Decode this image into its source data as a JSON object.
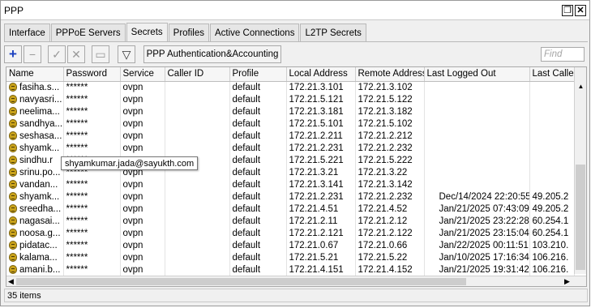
{
  "window": {
    "title": "PPP",
    "restore_glyph": "❐",
    "close_glyph": "✕"
  },
  "tabs": [
    "Interface",
    "PPPoE Servers",
    "Secrets",
    "Profiles",
    "Active Connections",
    "L2TP Secrets"
  ],
  "toolbar": {
    "add_glyph": "+",
    "remove_glyph": "−",
    "enable_glyph": "✓",
    "disable_glyph": "✕",
    "comment_glyph": "▭",
    "filter_glyph": "▽",
    "auth_label": "PPP Authentication&Accounting",
    "find_placeholder": "Find"
  },
  "columns": [
    "Name",
    "Password",
    "Service",
    "Caller ID",
    "Profile",
    "Local Address",
    "Remote Address",
    "Last Logged Out",
    "Last Calle"
  ],
  "rows": [
    {
      "name": "fasiha.s...",
      "password": "******",
      "service": "ovpn",
      "caller_id": "",
      "profile": "default",
      "local": "172.21.3.101",
      "remote": "172.21.3.102",
      "last_out": "",
      "last_caller": ""
    },
    {
      "name": "navyasri...",
      "password": "******",
      "service": "ovpn",
      "caller_id": "",
      "profile": "default",
      "local": "172.21.5.121",
      "remote": "172.21.5.122",
      "last_out": "",
      "last_caller": ""
    },
    {
      "name": "neelima...",
      "password": "******",
      "service": "ovpn",
      "caller_id": "",
      "profile": "default",
      "local": "172.21.3.181",
      "remote": "172.21.3.182",
      "last_out": "",
      "last_caller": ""
    },
    {
      "name": "sandhya...",
      "password": "******",
      "service": "ovpn",
      "caller_id": "",
      "profile": "default",
      "local": "172.21.5.101",
      "remote": "172.21.5.102",
      "last_out": "",
      "last_caller": ""
    },
    {
      "name": "seshasa...",
      "password": "******",
      "service": "ovpn",
      "caller_id": "",
      "profile": "default",
      "local": "172.21.2.211",
      "remote": "172.21.2.212",
      "last_out": "",
      "last_caller": ""
    },
    {
      "name": "shyamk...",
      "password": "******",
      "service": "ovpn",
      "caller_id": "",
      "profile": "default",
      "local": "172.21.2.231",
      "remote": "172.21.2.232",
      "last_out": "",
      "last_caller": ""
    },
    {
      "name": "sindhu.r",
      "password": "******",
      "service": "ovpn",
      "caller_id": "",
      "profile": "default",
      "local": "172.21.5.221",
      "remote": "172.21.5.222",
      "last_out": "",
      "last_caller": ""
    },
    {
      "name": "srinu.po...",
      "password": "******",
      "service": "ovpn",
      "caller_id": "",
      "profile": "default",
      "local": "172.21.3.21",
      "remote": "172.21.3.22",
      "last_out": "",
      "last_caller": ""
    },
    {
      "name": "vandan...",
      "password": "******",
      "service": "ovpn",
      "caller_id": "",
      "profile": "default",
      "local": "172.21.3.141",
      "remote": "172.21.3.142",
      "last_out": "",
      "last_caller": ""
    },
    {
      "name": "shyamk...",
      "password": "******",
      "service": "ovpn",
      "caller_id": "",
      "profile": "default",
      "local": "172.21.2.231",
      "remote": "172.21.2.232",
      "last_out": "Dec/14/2024 22:20:55",
      "last_caller": "49.205.2"
    },
    {
      "name": "sreedha...",
      "password": "******",
      "service": "ovpn",
      "caller_id": "",
      "profile": "default",
      "local": "172.21.4.51",
      "remote": "172.21.4.52",
      "last_out": "Jan/21/2025 07:43:09",
      "last_caller": "49.205.2"
    },
    {
      "name": "nagasai...",
      "password": "******",
      "service": "ovpn",
      "caller_id": "",
      "profile": "default",
      "local": "172.21.2.11",
      "remote": "172.21.2.12",
      "last_out": "Jan/21/2025 23:22:28",
      "last_caller": "60.254.1"
    },
    {
      "name": "noosa.g...",
      "password": "******",
      "service": "ovpn",
      "caller_id": "",
      "profile": "default",
      "local": "172.21.2.121",
      "remote": "172.21.2.122",
      "last_out": "Jan/21/2025 23:15:04",
      "last_caller": "60.254.1"
    },
    {
      "name": "pidatac...",
      "password": "******",
      "service": "ovpn",
      "caller_id": "",
      "profile": "default",
      "local": "172.21.0.67",
      "remote": "172.21.0.66",
      "last_out": "Jan/22/2025 00:11:51",
      "last_caller": "103.210."
    },
    {
      "name": "kalama...",
      "password": "******",
      "service": "ovpn",
      "caller_id": "",
      "profile": "default",
      "local": "172.21.5.21",
      "remote": "172.21.5.22",
      "last_out": "Jan/10/2025 17:16:34",
      "last_caller": "106.216."
    },
    {
      "name": "amani.b...",
      "password": "******",
      "service": "ovpn",
      "caller_id": "",
      "profile": "default",
      "local": "172.21.4.151",
      "remote": "172.21.4.152",
      "last_out": "Jan/21/2025 19:31:42",
      "last_caller": "106.216."
    }
  ],
  "tooltip": "shyamkumar.jada@sayukth.com",
  "status": "35 items",
  "colors": {
    "accent_add": "#1a3fbf",
    "lock_icon": "#c9a21a"
  }
}
